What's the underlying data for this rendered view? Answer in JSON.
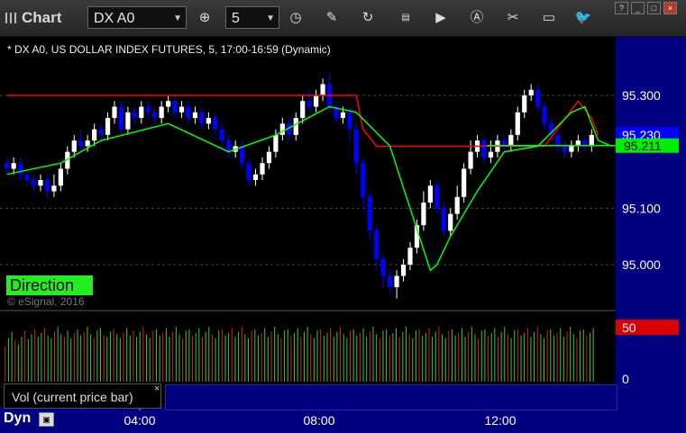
{
  "toolbar": {
    "title": "Chart",
    "symbol": "DX A0",
    "interval": "5",
    "icons": [
      "crosshair-icon",
      "clock-icon",
      "pencil-icon",
      "refresh-icon",
      "get-icon",
      "play-icon",
      "alert-icon",
      "tools-icon",
      "chat-icon",
      "twitter-icon"
    ],
    "window_buttons": [
      "?",
      "_",
      "□",
      "×"
    ]
  },
  "chart": {
    "header": "* DX A0, US DOLLAR INDEX FUTURES, 5, 17:00-16:59 (Dynamic)",
    "direction_label": "Direction",
    "copyright": "© eSignal, 2016",
    "price_ticks": [
      "95.300",
      "95.100",
      "95.000"
    ],
    "last_price": "95.230",
    "green_level": "95.211",
    "vol_marker": "50",
    "vol_zero": "0",
    "time_ticks": [
      "04:00",
      "08:00",
      "12:00"
    ],
    "vol_label": "Vol (current price bar)",
    "vol_close": "×",
    "mode": "Dyn",
    "colors": {
      "up_candle": "#ffffff",
      "down_candle": "#0000ff",
      "line_red": "#ff0000",
      "line_green": "#00ff00",
      "axis_bg": "#000080",
      "price_tag": "#0000ff",
      "green_tag": "#00ee00",
      "vol_tag": "#dd0000"
    }
  },
  "chart_data": {
    "type": "candlestick",
    "title": "* DX A0, US DOLLAR INDEX FUTURES, 5, 17:00-16:59 (Dynamic)",
    "ylim": [
      94.925,
      95.375
    ],
    "y_ticks": [
      95.0,
      95.1,
      95.3
    ],
    "x_ticks": [
      "04:00",
      "08:00",
      "12:00"
    ],
    "last_price": 95.23,
    "green_level": 95.211,
    "candles": [
      [
        95.18,
        95.17,
        95.19,
        95.16
      ],
      [
        95.17,
        95.18,
        95.19,
        95.16
      ],
      [
        95.18,
        95.16,
        95.19,
        95.15
      ],
      [
        95.16,
        95.15,
        95.17,
        95.14
      ],
      [
        95.15,
        95.14,
        95.16,
        95.13
      ],
      [
        95.14,
        95.15,
        95.16,
        95.13
      ],
      [
        95.15,
        95.13,
        95.16,
        95.12
      ],
      [
        95.13,
        95.14,
        95.16,
        95.12
      ],
      [
        95.14,
        95.17,
        95.18,
        95.13
      ],
      [
        95.17,
        95.2,
        95.21,
        95.16
      ],
      [
        95.2,
        95.22,
        95.23,
        95.19
      ],
      [
        95.22,
        95.21,
        95.24,
        95.2
      ],
      [
        95.21,
        95.22,
        95.23,
        95.2
      ],
      [
        95.22,
        95.24,
        95.25,
        95.21
      ],
      [
        95.24,
        95.23,
        95.25,
        95.22
      ],
      [
        95.23,
        95.26,
        95.27,
        95.22
      ],
      [
        95.26,
        95.28,
        95.29,
        95.25
      ],
      [
        95.28,
        95.24,
        95.29,
        95.23
      ],
      [
        95.24,
        95.27,
        95.28,
        95.23
      ],
      [
        95.27,
        95.26,
        95.28,
        95.25
      ],
      [
        95.26,
        95.28,
        95.29,
        95.25
      ],
      [
        95.28,
        95.27,
        95.29,
        95.26
      ],
      [
        95.27,
        95.26,
        95.28,
        95.25
      ],
      [
        95.26,
        95.28,
        95.29,
        95.25
      ],
      [
        95.28,
        95.29,
        95.3,
        95.27
      ],
      [
        95.29,
        95.27,
        95.3,
        95.26
      ],
      [
        95.27,
        95.28,
        95.29,
        95.26
      ],
      [
        95.28,
        95.26,
        95.29,
        95.25
      ],
      [
        95.26,
        95.27,
        95.28,
        95.25
      ],
      [
        95.27,
        95.25,
        95.28,
        95.24
      ],
      [
        95.25,
        95.26,
        95.27,
        95.24
      ],
      [
        95.26,
        95.24,
        95.27,
        95.23
      ],
      [
        95.24,
        95.22,
        95.25,
        95.21
      ],
      [
        95.22,
        95.2,
        95.23,
        95.19
      ],
      [
        95.2,
        95.21,
        95.22,
        95.19
      ],
      [
        95.21,
        95.18,
        95.22,
        95.17
      ],
      [
        95.18,
        95.15,
        95.19,
        95.14
      ],
      [
        95.15,
        95.16,
        95.17,
        95.14
      ],
      [
        95.16,
        95.18,
        95.19,
        95.15
      ],
      [
        95.18,
        95.2,
        95.21,
        95.17
      ],
      [
        95.2,
        95.23,
        95.24,
        95.19
      ],
      [
        95.23,
        95.25,
        95.26,
        95.22
      ],
      [
        95.25,
        95.23,
        95.26,
        95.22
      ],
      [
        95.23,
        95.26,
        95.27,
        95.22
      ],
      [
        95.26,
        95.29,
        95.3,
        95.25
      ],
      [
        95.29,
        95.28,
        95.31,
        95.27
      ],
      [
        95.28,
        95.3,
        95.31,
        95.27
      ],
      [
        95.3,
        95.32,
        95.33,
        95.29
      ],
      [
        95.32,
        95.28,
        95.34,
        95.27
      ],
      [
        95.28,
        95.26,
        95.29,
        95.25
      ],
      [
        95.26,
        95.27,
        95.28,
        95.25
      ],
      [
        95.27,
        95.24,
        95.28,
        95.22
      ],
      [
        95.24,
        95.18,
        95.25,
        95.16
      ],
      [
        95.18,
        95.12,
        95.19,
        95.1
      ],
      [
        95.12,
        95.06,
        95.13,
        95.04
      ],
      [
        95.06,
        95.01,
        95.07,
        94.99
      ],
      [
        95.01,
        94.98,
        95.02,
        94.96
      ],
      [
        94.98,
        94.96,
        94.99,
        94.95
      ],
      [
        94.96,
        94.98,
        94.99,
        94.94
      ],
      [
        94.98,
        95.0,
        95.01,
        94.97
      ],
      [
        95.0,
        95.03,
        95.04,
        94.99
      ],
      [
        95.03,
        95.07,
        95.08,
        95.02
      ],
      [
        95.07,
        95.11,
        95.13,
        95.06
      ],
      [
        95.11,
        95.14,
        95.15,
        95.1
      ],
      [
        95.14,
        95.1,
        95.15,
        95.09
      ],
      [
        95.1,
        95.06,
        95.11,
        95.05
      ],
      [
        95.06,
        95.09,
        95.1,
        95.05
      ],
      [
        95.09,
        95.12,
        95.14,
        95.08
      ],
      [
        95.12,
        95.17,
        95.18,
        95.11
      ],
      [
        95.17,
        95.2,
        95.22,
        95.16
      ],
      [
        95.2,
        95.22,
        95.23,
        95.19
      ],
      [
        95.22,
        95.19,
        95.23,
        95.18
      ],
      [
        95.19,
        95.2,
        95.22,
        95.18
      ],
      [
        95.2,
        95.22,
        95.23,
        95.19
      ],
      [
        95.22,
        95.21,
        95.23,
        95.2
      ],
      [
        95.21,
        95.23,
        95.24,
        95.2
      ],
      [
        95.23,
        95.27,
        95.28,
        95.22
      ],
      [
        95.27,
        95.3,
        95.31,
        95.26
      ],
      [
        95.3,
        95.31,
        95.32,
        95.29
      ],
      [
        95.31,
        95.28,
        95.32,
        95.27
      ],
      [
        95.28,
        95.25,
        95.29,
        95.24
      ],
      [
        95.25,
        95.23,
        95.26,
        95.22
      ],
      [
        95.23,
        95.21,
        95.24,
        95.2
      ],
      [
        95.21,
        95.2,
        95.22,
        95.19
      ],
      [
        95.2,
        95.21,
        95.22,
        95.19
      ],
      [
        95.21,
        95.22,
        95.23,
        95.2
      ],
      [
        95.22,
        95.21,
        95.23,
        95.2
      ],
      [
        95.21,
        95.23,
        95.24,
        95.2
      ]
    ],
    "series": [
      {
        "color": "line_red",
        "values": [
          [
            0,
            95.3
          ],
          [
            30,
            95.3
          ],
          [
            52,
            95.3
          ],
          [
            53,
            95.24
          ],
          [
            55,
            95.21
          ],
          [
            56,
            95.21
          ],
          [
            60,
            95.21
          ],
          [
            80,
            95.21
          ],
          [
            85,
            95.29
          ],
          [
            87,
            95.26
          ],
          [
            88,
            95.23
          ]
        ]
      },
      {
        "color": "line_green",
        "values": [
          [
            0,
            95.16
          ],
          [
            8,
            95.18
          ],
          [
            14,
            95.22
          ],
          [
            24,
            95.25
          ],
          [
            33,
            95.2
          ],
          [
            40,
            95.23
          ],
          [
            48,
            95.28
          ],
          [
            52,
            95.27
          ],
          [
            57,
            95.21
          ],
          [
            60,
            95.1
          ],
          [
            63,
            94.99
          ],
          [
            64,
            95.0
          ],
          [
            66,
            95.05
          ],
          [
            70,
            95.13
          ],
          [
            74,
            95.2
          ],
          [
            79,
            95.21
          ],
          [
            84,
            95.27
          ],
          [
            86,
            95.28
          ],
          [
            88,
            95.22
          ],
          [
            90,
            95.21
          ]
        ]
      }
    ],
    "volume": [
      28,
      35,
      40,
      33,
      30,
      36,
      41,
      34,
      38,
      42,
      36,
      39,
      43,
      37,
      35,
      40,
      44,
      38,
      36,
      41,
      35,
      39,
      42,
      37,
      40,
      44,
      38,
      35,
      41,
      43,
      37,
      36,
      40,
      42,
      38,
      35,
      39,
      43,
      37,
      41,
      36,
      40,
      44,
      38,
      35,
      41,
      42,
      37,
      39,
      43,
      36,
      40,
      44,
      38,
      35,
      41,
      42,
      37,
      39,
      43,
      36,
      40,
      44,
      38,
      35,
      41,
      42,
      37,
      39,
      43,
      36,
      40,
      44,
      38,
      35,
      41,
      42,
      37,
      39,
      43,
      36,
      40,
      44,
      38,
      35,
      41,
      42,
      37,
      39,
      43,
      36,
      40,
      44,
      38,
      35,
      41,
      42,
      37,
      39,
      43,
      36,
      40,
      44,
      38,
      35,
      41,
      42,
      37,
      39,
      43,
      36,
      40,
      44,
      38,
      35,
      41,
      42,
      37,
      39,
      43,
      36,
      40,
      44,
      38,
      35,
      41,
      42,
      37,
      39,
      43,
      36,
      40,
      44,
      38,
      35,
      41,
      42,
      37,
      39,
      43,
      36,
      40,
      44,
      38,
      35,
      41,
      42,
      37,
      39,
      43,
      36,
      40,
      44,
      38,
      35,
      41,
      42,
      37,
      39,
      43,
      36,
      40,
      44,
      38,
      35,
      41,
      42,
      37,
      39,
      43,
      36,
      40,
      44,
      38,
      35,
      41,
      42,
      37,
      39,
      43
    ]
  }
}
